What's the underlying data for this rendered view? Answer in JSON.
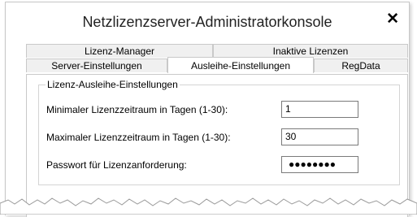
{
  "window": {
    "title": "Netzlizenzserver-Administratorkonsole",
    "close_label": "✕"
  },
  "tabs": {
    "row1": [
      "Lizenz-Manager",
      "Inaktive Lizenzen"
    ],
    "row2": [
      "Server-Einstellungen",
      "Ausleihe-Einstellungen",
      "RegData"
    ],
    "active": "Ausleihe-Einstellungen"
  },
  "group": {
    "legend": "Lizenz-Ausleihe-Einstellungen",
    "min_label": "Minimaler Lizenzzeitraum in Tagen (1-30):",
    "min_value": "1",
    "max_label": "Maximaler Lizenzzeitraum in Tagen (1-30):",
    "max_value": "30",
    "password_label": "Passwort für Lizenzanforderung:",
    "password_mask": "●●●●●●●●"
  },
  "colors": {
    "eye_icon": "#1a8fd6",
    "border": "#c9c9c9"
  }
}
